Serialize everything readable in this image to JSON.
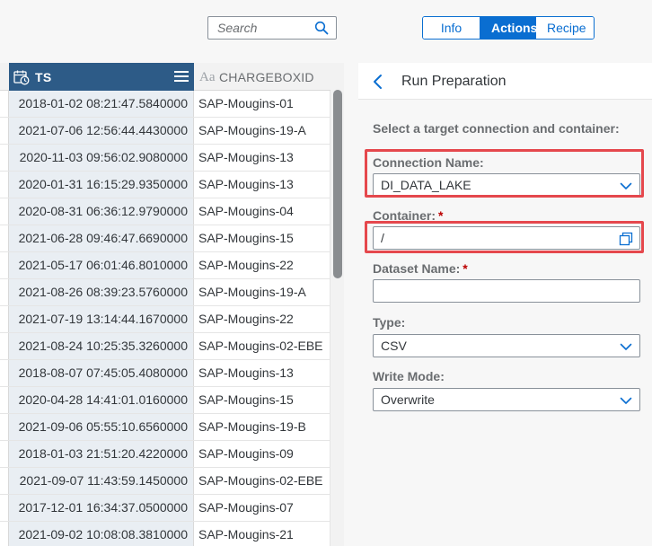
{
  "search": {
    "placeholder": "Search"
  },
  "tabs": {
    "info": "Info",
    "actions": "Actions",
    "recipe": "Recipe",
    "active": "Actions"
  },
  "grid": {
    "columns": [
      {
        "type_icon": "calendar-clock-icon",
        "label": "TS"
      },
      {
        "type_icon": "text-type-icon",
        "type_glyph": "Aa",
        "label": "CHARGEBOXID"
      }
    ],
    "rows": [
      {
        "ts": "2018-01-02 08:21:47.5840000",
        "chargeboxid": "SAP-Mougins-01"
      },
      {
        "ts": "2021-07-06 12:56:44.4430000",
        "chargeboxid": "SAP-Mougins-19-A"
      },
      {
        "ts": "2020-11-03 09:56:02.9080000",
        "chargeboxid": "SAP-Mougins-13"
      },
      {
        "ts": "2020-01-31 16:15:29.9350000",
        "chargeboxid": "SAP-Mougins-13"
      },
      {
        "ts": "2020-08-31 06:36:12.9790000",
        "chargeboxid": "SAP-Mougins-04"
      },
      {
        "ts": "2021-06-28 09:46:47.6690000",
        "chargeboxid": "SAP-Mougins-15"
      },
      {
        "ts": "2021-05-17 06:01:46.8010000",
        "chargeboxid": "SAP-Mougins-22"
      },
      {
        "ts": "2021-08-26 08:39:23.5760000",
        "chargeboxid": "SAP-Mougins-19-A"
      },
      {
        "ts": "2021-07-19 13:14:44.1670000",
        "chargeboxid": "SAP-Mougins-22"
      },
      {
        "ts": "2021-08-24 10:25:35.3260000",
        "chargeboxid": "SAP-Mougins-02-EBE"
      },
      {
        "ts": "2018-08-07 07:45:05.4080000",
        "chargeboxid": "SAP-Mougins-13"
      },
      {
        "ts": "2020-04-28 14:41:01.0160000",
        "chargeboxid": "SAP-Mougins-15"
      },
      {
        "ts": "2021-09-06 05:55:10.6560000",
        "chargeboxid": "SAP-Mougins-19-B"
      },
      {
        "ts": "2018-01-03 21:51:20.4220000",
        "chargeboxid": "SAP-Mougins-09"
      },
      {
        "ts": "2021-09-07 11:43:59.1450000",
        "chargeboxid": "SAP-Mougins-02-EBE"
      },
      {
        "ts": "2017-12-01 16:34:37.0500000",
        "chargeboxid": "SAP-Mougins-07"
      },
      {
        "ts": "2021-09-02 10:08:08.3810000",
        "chargeboxid": "SAP-Mougins-21"
      }
    ]
  },
  "panel": {
    "title": "Run Preparation",
    "instruction": "Select a target connection and container:",
    "connection": {
      "label": "Connection Name:",
      "value": "DI_DATA_LAKE"
    },
    "container": {
      "label": "Container:",
      "required_mark": "*",
      "value": "/"
    },
    "dataset": {
      "label": "Dataset Name:",
      "required_mark": "*",
      "value": ""
    },
    "type": {
      "label": "Type:",
      "value": "CSV"
    },
    "write_mode": {
      "label": "Write Mode:",
      "value": "Overwrite"
    }
  },
  "colors": {
    "accent": "#0a6ed1",
    "header_column": "#2d5b87",
    "highlight": "#e5484d",
    "required": "#bb0000"
  }
}
